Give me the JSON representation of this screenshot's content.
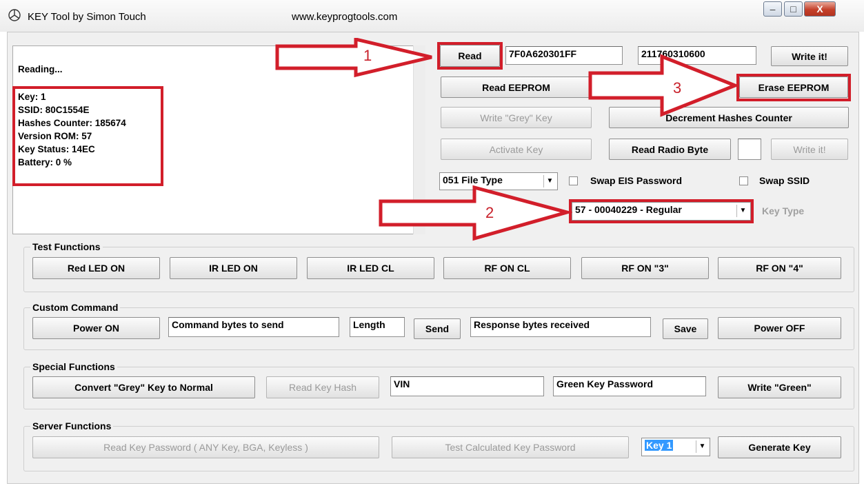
{
  "window": {
    "title": "KEY Tool by Simon Touch",
    "url": "www.keyprogtools.com",
    "minimize": "‒",
    "maximize": "□",
    "close": "X"
  },
  "log": {
    "reading": "Reading...",
    "lines": [
      "Key: 1",
      "SSID: 80C1554E",
      "Hashes Counter: 185674",
      "Version ROM: 57",
      "Key Status: 14EC",
      "Battery: 0 %"
    ]
  },
  "top": {
    "read": "Read",
    "field1": "7F0A620301FF",
    "field2": "211760310600",
    "write_it": "Write it!",
    "read_eeprom": "Read EEPROM",
    "erase_eeprom": "Erase EEPROM",
    "write_grey": "Write \"Grey\" Key",
    "decrement": "Decrement Hashes Counter",
    "activate": "Activate Key",
    "read_radio": "Read Radio Byte",
    "radio_value": "",
    "write_it2": "Write it!",
    "file_type": "051 File Type",
    "swap_eis": "Swap EIS Password",
    "swap_ssid": "Swap SSID",
    "key_type_value": "57 - 00040229 - Regular",
    "key_type_label": "Key Type"
  },
  "annotations": {
    "n1": "1",
    "n2": "2",
    "n3": "3"
  },
  "test": {
    "title": "Test Functions",
    "buttons": [
      "Red LED ON",
      "IR LED ON",
      "IR LED CL",
      "RF ON CL",
      "RF ON \"3\"",
      "RF ON \"4\""
    ]
  },
  "custom": {
    "title": "Custom Command",
    "power_on": "Power ON",
    "cmd": "Command bytes to send",
    "length": "Length",
    "send": "Send",
    "response": "Response bytes received",
    "save": "Save",
    "power_off": "Power OFF"
  },
  "special": {
    "title": "Special Functions",
    "convert": "Convert \"Grey\" Key to Normal",
    "read_hash": "Read Key Hash",
    "vin": "VIN",
    "green_pw": "Green Key Password",
    "write_green": "Write \"Green\""
  },
  "server": {
    "title": "Server Functions",
    "read_pw": "Read Key Password ( ANY Key, BGA, Keyless )",
    "test_calc": "Test Calculated Key Password",
    "key_select": "Key 1",
    "generate": "Generate Key"
  },
  "colors": {
    "annotation_red": "#d21e2a",
    "face": "#f0f0f0"
  }
}
